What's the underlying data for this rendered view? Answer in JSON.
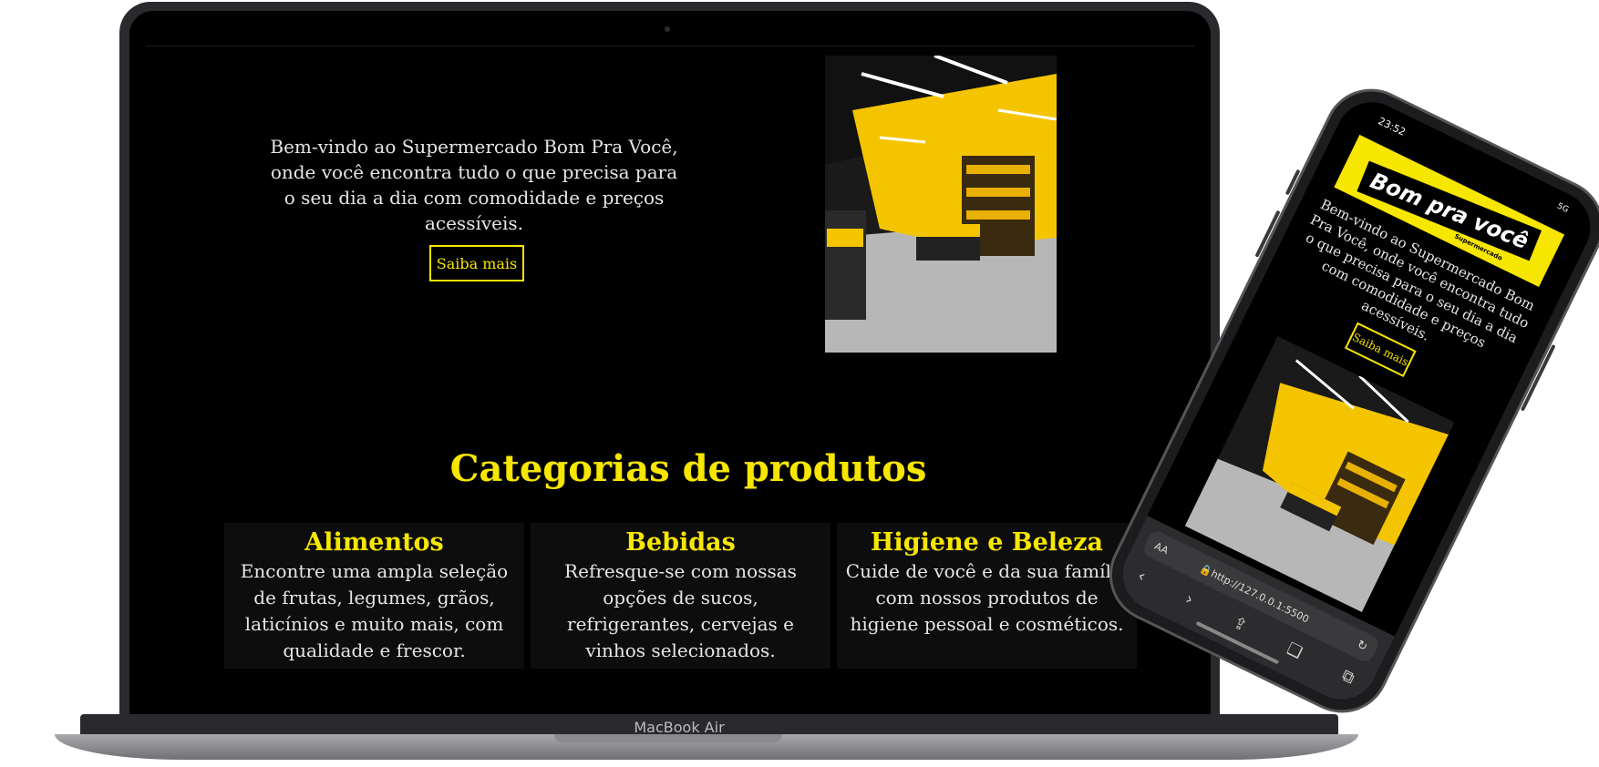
{
  "laptop": {
    "hero": {
      "text": "Bem-vindo ao Supermercado Bom Pra Você, onde você encontra tudo o que precisa para o seu dia a dia com comodidade e preços acessíveis.",
      "button_label": "Saiba mais"
    },
    "categories": {
      "title": "Categorias de produtos",
      "items": [
        {
          "title": "Alimentos",
          "text": "Encontre uma ampla seleção de frutas, legumes, grãos, laticínios e muito mais, com qualidade e frescor."
        },
        {
          "title": "Bebidas",
          "text": "Refresque-se com nossas opções de sucos, refrigerantes, cervejas e vinhos selecionados."
        },
        {
          "title": "Higiene e Beleza",
          "text": "Cuide de você e da sua família com nossos produtos de higiene pessoal e cosméticos."
        }
      ]
    },
    "base_label": "MacBook Air"
  },
  "phone": {
    "time": "23:52",
    "status": "5G",
    "logo_text": "Bom pra você",
    "logo_sub": "Supermercado",
    "hero_text": "Bem-vindo ao Supermercado Bom Pra Você, onde você encontra tudo o que precisa para o seu dia a dia com comodidade e preços acessíveis.",
    "button_label": "Saiba mais",
    "browser": {
      "aa_label": "AA",
      "url": "http://127.0.0.1:5500",
      "nav_icons": [
        "back-icon",
        "forward-icon",
        "share-icon",
        "bookmarks-icon",
        "tabs-icon"
      ]
    }
  },
  "colors": {
    "accent": "#f7e600",
    "background": "#000000",
    "text": "#e6e6e6"
  }
}
